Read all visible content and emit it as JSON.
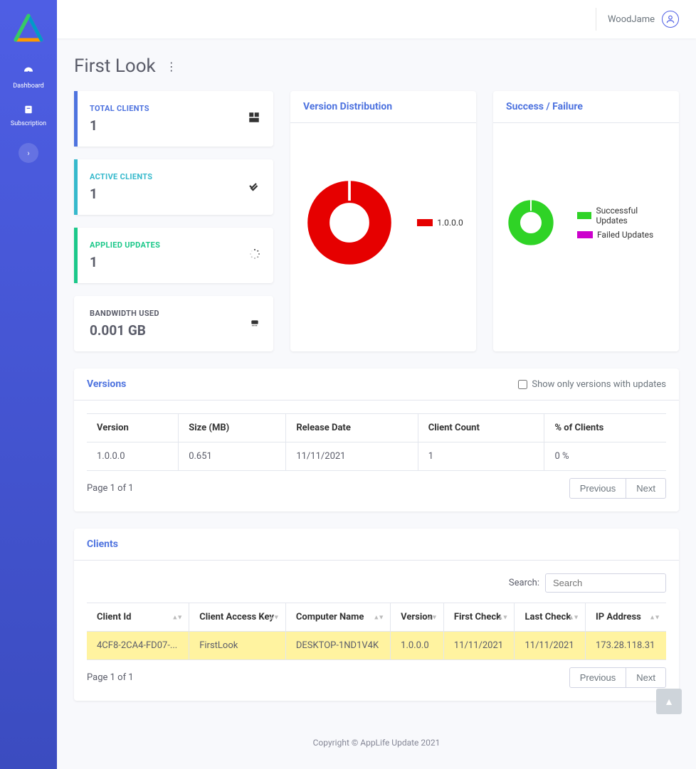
{
  "sidebar": {
    "items": [
      {
        "label": "Dashboard"
      },
      {
        "label": "Subscription"
      }
    ]
  },
  "header": {
    "username": "WoodJame"
  },
  "page": {
    "title": "First Look"
  },
  "stats": {
    "total_clients": {
      "label": "TOTAL CLIENTS",
      "value": "1"
    },
    "active_clients": {
      "label": "ACTIVE CLIENTS",
      "value": "1"
    },
    "applied_updates": {
      "label": "APPLIED UPDATES",
      "value": "1"
    },
    "bandwidth": {
      "label": "BANDWIDTH USED",
      "value": "0.001 GB"
    }
  },
  "version_dist": {
    "title": "Version Distribution",
    "legend": [
      {
        "label": "1.0.0.0",
        "color": "#e60000"
      }
    ]
  },
  "success_failure": {
    "title": "Success / Failure",
    "legend": [
      {
        "label": "Successful Updates",
        "color": "#2fd326"
      },
      {
        "label": "Failed Updates",
        "color": "#cc00cc"
      }
    ]
  },
  "versions": {
    "title": "Versions",
    "show_only_label": "Show only versions with updates",
    "columns": [
      "Version",
      "Size (MB)",
      "Release Date",
      "Client Count",
      "% of Clients"
    ],
    "rows": [
      {
        "version": "1.0.0.0",
        "size": "0.651",
        "release": "11/11/2021",
        "count": "1",
        "pct": "0 %"
      }
    ],
    "page_info": "Page 1 of 1",
    "prev": "Previous",
    "next": "Next"
  },
  "clients": {
    "title": "Clients",
    "search_label": "Search:",
    "search_placeholder": "Search",
    "columns": [
      "Client Id",
      "Client Access Key",
      "Computer Name",
      "Version",
      "First Check",
      "Last Check",
      "IP Address"
    ],
    "rows": [
      {
        "id": "4CF8-2CA4-FD07-...",
        "key": "FirstLook",
        "computer": "DESKTOP-1ND1V4K",
        "version": "1.0.0.0",
        "first": "11/11/2021",
        "last": "11/11/2021",
        "ip": "173.28.118.31"
      }
    ],
    "page_info": "Page 1 of 1",
    "prev": "Previous",
    "next": "Next"
  },
  "footer": {
    "copyright": "Copyright © AppLife Update 2021"
  },
  "chart_data": [
    {
      "type": "pie",
      "title": "Version Distribution",
      "series": [
        {
          "name": "1.0.0.0",
          "value": 100,
          "color": "#e60000"
        }
      ]
    },
    {
      "type": "pie",
      "title": "Success / Failure",
      "series": [
        {
          "name": "Successful Updates",
          "value": 100,
          "color": "#2fd326"
        },
        {
          "name": "Failed Updates",
          "value": 0,
          "color": "#cc00cc"
        }
      ]
    }
  ]
}
